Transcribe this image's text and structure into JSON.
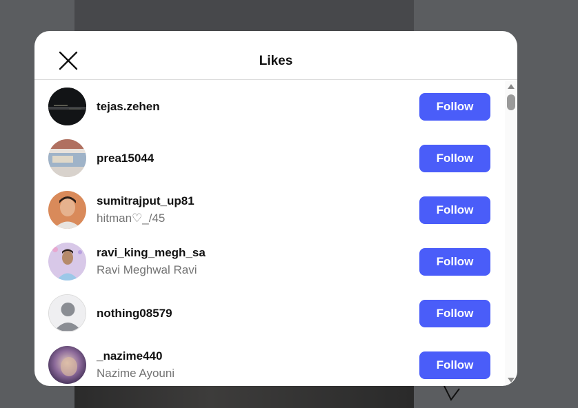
{
  "modal": {
    "title": "Likes"
  },
  "users": [
    {
      "username": "tejas.zehen",
      "full_name": "",
      "button_label": "Follow"
    },
    {
      "username": "prea15044",
      "full_name": "",
      "button_label": "Follow"
    },
    {
      "username": "sumitrajput_up81",
      "full_name": "hitman♡_/45",
      "button_label": "Follow"
    },
    {
      "username": "ravi_king_megh_sa",
      "full_name": "Ravi Meghwal Ravi",
      "button_label": "Follow"
    },
    {
      "username": "nothing08579",
      "full_name": "",
      "button_label": "Follow"
    },
    {
      "username": "_nazime440",
      "full_name": "Nazime Ayouni",
      "button_label": "Follow"
    }
  ],
  "colors": {
    "follow_button": "#4a5df9",
    "overlay": "#5b5d60"
  },
  "icons": {
    "close": "close-icon",
    "default_avatar": "default-avatar-icon"
  }
}
